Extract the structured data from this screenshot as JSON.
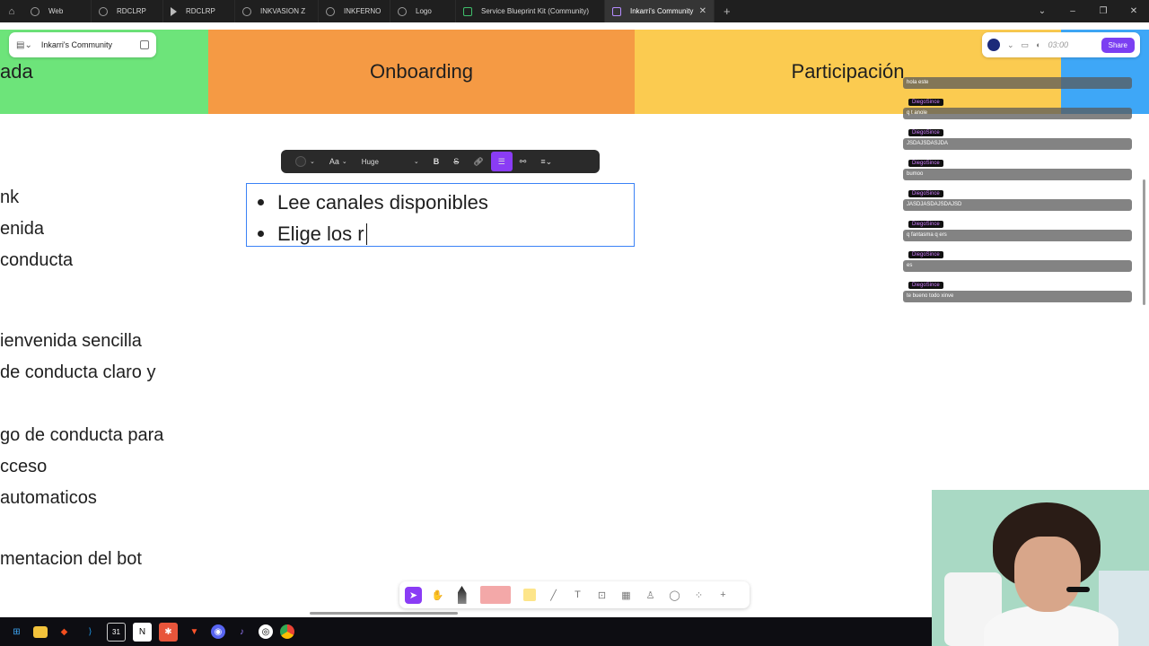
{
  "browser": {
    "tabs": [
      {
        "label": "Web",
        "icon": "globe-icon"
      },
      {
        "label": "RDCLRP",
        "icon": "link-icon"
      },
      {
        "label": "RDCLRP",
        "icon": "play-icon"
      },
      {
        "label": "INKVASION Z",
        "icon": "link-icon"
      },
      {
        "label": "INKFERNO",
        "icon": "link-icon"
      },
      {
        "label": "Logo",
        "icon": "link-icon"
      },
      {
        "label": "Service Blueprint Kit (Community)",
        "icon": "leaf-icon"
      },
      {
        "label": "Inkarri's Community",
        "icon": "doc-icon"
      }
    ],
    "active_tab_index": 7
  },
  "board": {
    "doc_title": "Inkarri's Community",
    "lanes": [
      {
        "label": "ada",
        "color": "#6de47a"
      },
      {
        "label": "Onboarding",
        "color": "#f59a44"
      },
      {
        "label": "Participación",
        "color": "#fbcb50"
      },
      {
        "label": "",
        "color": "#3ea7f7"
      }
    ],
    "left_lines": [
      "nk",
      "enida",
      " conducta",
      "ienvenida sencilla",
      "de conducta claro y",
      "go de conducta para",
      "cceso",
      " automaticos",
      "mentacion del bot"
    ],
    "textbox": {
      "items": [
        "Lee canales disponibles",
        "Elige los r"
      ]
    },
    "format_toolbar": {
      "font_label": "Aa",
      "size_label": "Huge",
      "bold": "B",
      "strike": "S"
    },
    "top_right": {
      "timer": "03:00",
      "share_label": "Share"
    }
  },
  "chat": {
    "top_msg": "hola este",
    "messages": [
      {
        "user": "DiegoSince",
        "text": "q t anole"
      },
      {
        "user": "DiegoSince",
        "text": "JSDAJSDASJDA"
      },
      {
        "user": "DiegoSince",
        "text": "bumoo"
      },
      {
        "user": "DiegoSince",
        "text": "JASDJASDAJSDAJSD"
      },
      {
        "user": "DiegoSince",
        "text": "q fantasma q ers"
      },
      {
        "user": "DiegoSince",
        "text": "es"
      },
      {
        "user": "DiegoSince",
        "text": "te bueno todo xinve"
      }
    ]
  },
  "colors": {
    "accent": "#8a3cf5",
    "selection": "#3b82f6"
  }
}
